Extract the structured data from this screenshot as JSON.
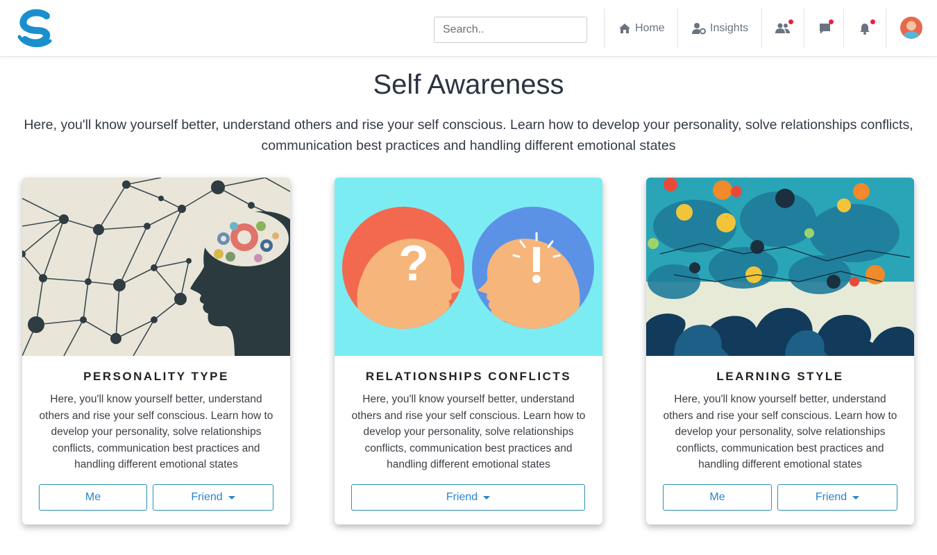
{
  "header": {
    "search_placeholder": "Search..",
    "nav": {
      "home": "Home",
      "insights": "Insights"
    }
  },
  "page": {
    "title": "Self Awareness",
    "intro": "Here, you'll know yourself better, understand others and rise your self conscious. Learn how to develop your personality, solve relationships conflicts, communication best practices and handling different emotional states"
  },
  "cards": [
    {
      "title": "PERSONALITY TYPE",
      "description": "Here, you'll know yourself better, understand others and rise your self conscious. Learn how to develop your personality, solve relationships conflicts, communication best practices and handling different emotional states",
      "me_label": "Me",
      "friend_label": "Friend"
    },
    {
      "title": "RELATIONSHIPS CONFLICTS",
      "description": "Here, you'll know yourself better, understand others and rise your self conscious. Learn how to develop your personality, solve relationships conflicts, communication best practices and handling different emotional states",
      "friend_label": "Friend"
    },
    {
      "title": "LEARNING STYLE",
      "description": "Here, you'll know yourself better, understand others and rise your self conscious. Learn how to develop your personality, solve relationships conflicts, communication best practices and handling different emotional states",
      "me_label": "Me",
      "friend_label": "Friend"
    }
  ],
  "colors": {
    "brand": "#1a8fcd",
    "button_border": "#2a8fb4",
    "button_text": "#2a84c9",
    "notification_dot": "#e8213e"
  }
}
